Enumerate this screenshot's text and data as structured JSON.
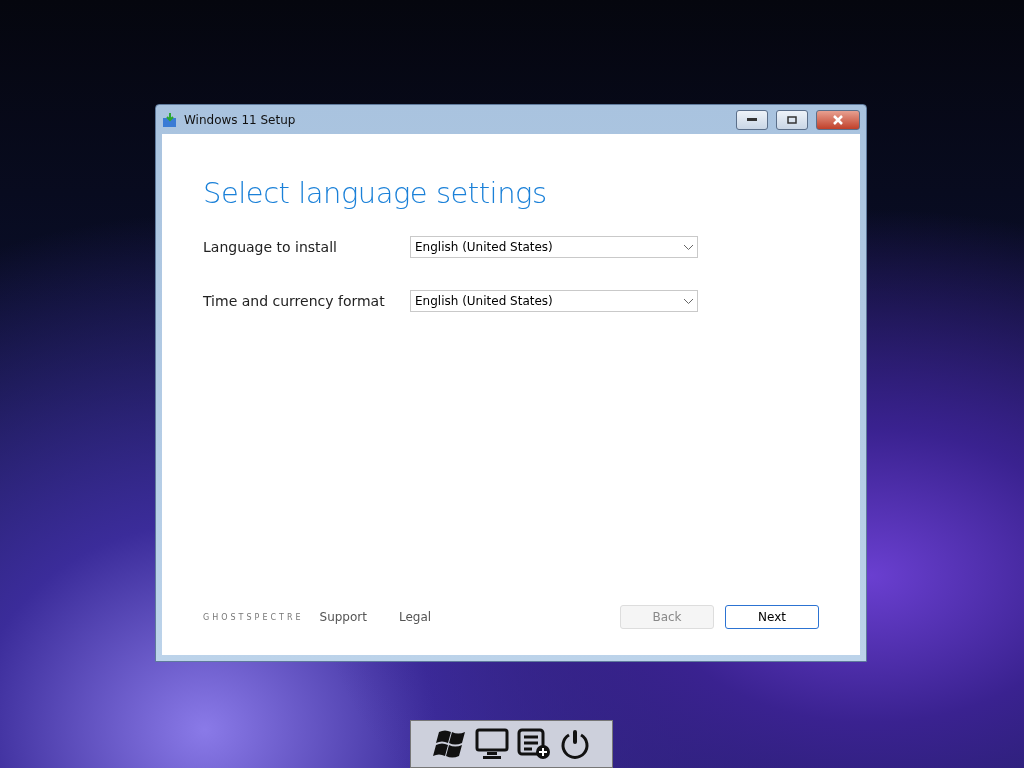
{
  "window": {
    "title": "Windows 11 Setup"
  },
  "heading": "Select language settings",
  "fields": [
    {
      "label": "Language to install",
      "value": "English (United States)"
    },
    {
      "label": "Time and currency format",
      "value": "English (United States)"
    }
  ],
  "footer": {
    "brand": "GHOSTSPECTRE",
    "links": [
      "Support",
      "Legal"
    ]
  },
  "buttons": [
    {
      "label": "Back",
      "disabled": true
    },
    {
      "label": "Next",
      "disabled": false
    }
  ]
}
